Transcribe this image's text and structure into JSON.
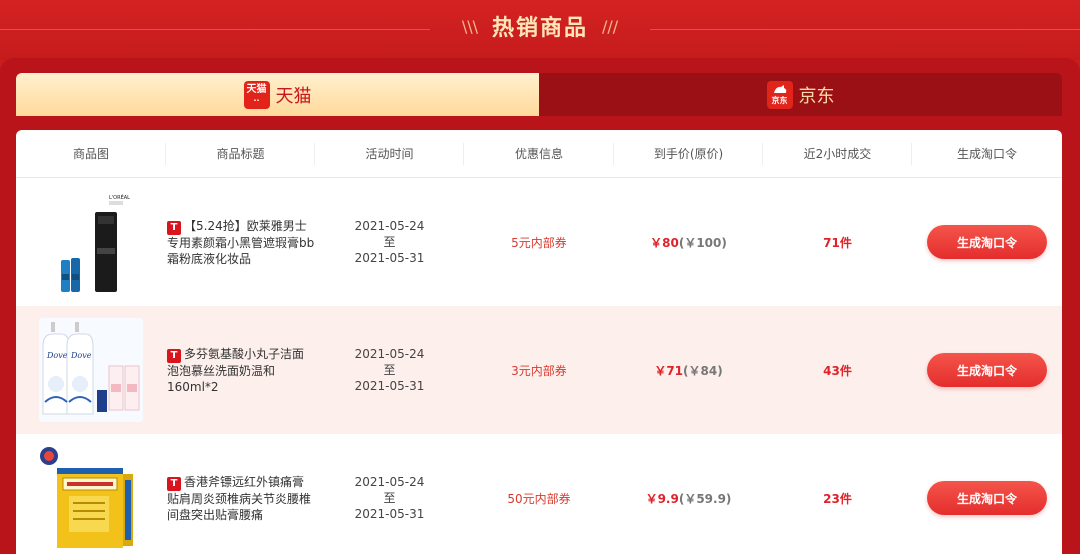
{
  "section": {
    "title": "热销商品",
    "left_deco": "\\\\\\",
    "right_deco": "///"
  },
  "tabs": [
    {
      "label": "天猫",
      "logo_text_top": "天猫",
      "logo_text_bottom": "··",
      "active": true
    },
    {
      "label": "京东",
      "logo_text_top": "🐕",
      "logo_text_bottom": "京东",
      "active": false
    }
  ],
  "table": {
    "headers": [
      "商品图",
      "商品标题",
      "活动时间",
      "优惠信息",
      "到手价(原价)",
      "近2小时成交",
      "生成淘口令"
    ],
    "rows": [
      {
        "platform_badge": "T",
        "title": "【5.24抢】欧莱雅男士专用素颜霜小黑管遮瑕膏bb霜粉底液化妆品",
        "time_start": "2021-05-24",
        "time_sep": "至",
        "time_end": "2021-05-31",
        "coupon": "5元内部券",
        "price": "￥80",
        "orig_price": "(￥100)",
        "sales": "71件",
        "button": "生成淘口令",
        "brand_mark": "L'ORÉAL"
      },
      {
        "platform_badge": "T",
        "title": "多芬氨基酸小丸子洁面泡泡慕丝洗面奶温和160ml*2",
        "time_start": "2021-05-24",
        "time_sep": "至",
        "time_end": "2021-05-31",
        "coupon": "3元内部券",
        "price": "￥71",
        "orig_price": "(￥84)",
        "sales": "43件",
        "button": "生成淘口令",
        "brand_mark": "Dove"
      },
      {
        "platform_badge": "T",
        "title": "香港斧镖远红外镇痛膏贴肩周炎颈椎病关节炎腰椎间盘突出贴膏腰痛",
        "time_start": "2021-05-24",
        "time_sep": "至",
        "time_end": "2021-05-31",
        "coupon": "50元内部券",
        "price": "￥9.9",
        "orig_price": "(￥59.9)",
        "sales": "23件",
        "button": "生成淘口令",
        "brand_mark": ""
      }
    ]
  },
  "colors": {
    "background": "#c91d1e",
    "accent": "#e0232a",
    "tab_active": "#ffd99b"
  }
}
